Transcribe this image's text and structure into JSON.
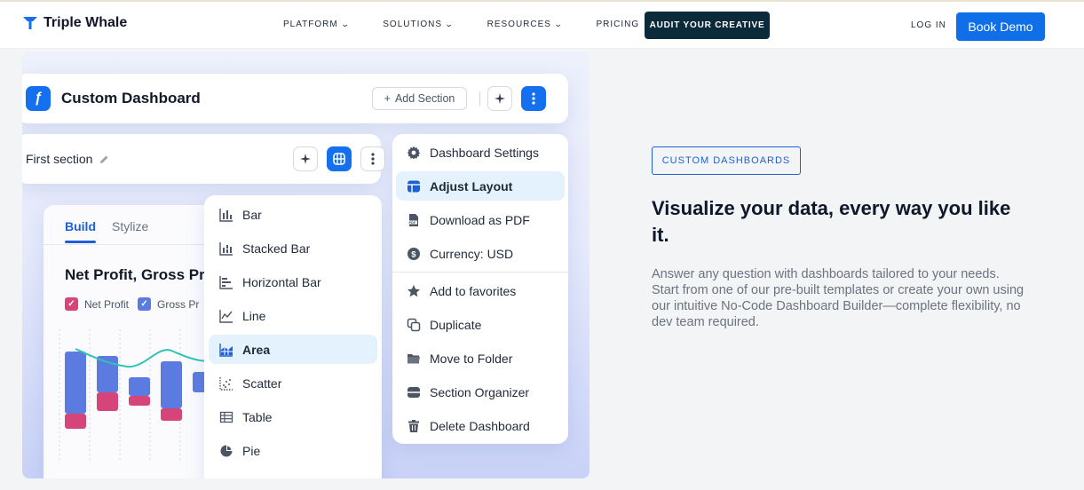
{
  "nav": {
    "brand": "Triple Whale",
    "links": [
      {
        "label": "PLATFORM",
        "has_dropdown": true
      },
      {
        "label": "SOLUTIONS",
        "has_dropdown": true
      },
      {
        "label": "RESOURCES",
        "has_dropdown": true
      },
      {
        "label": "PRICING",
        "has_dropdown": false
      }
    ],
    "audit_label": "AUDIT YOUR CREATIVE",
    "login_label": "LOG IN",
    "demo_label": "Book Demo"
  },
  "dashboard": {
    "title": "Custom Dashboard",
    "add_section_label": "Add Section",
    "section_title": "First section",
    "tabs": {
      "build": "Build",
      "stylize": "Stylize"
    },
    "metric_title": "Net Profit, Gross Pr",
    "legend": [
      {
        "label": "Net Profit",
        "color": "#d6457a"
      },
      {
        "label": "Gross Pr",
        "color": "#5b7be0"
      }
    ]
  },
  "chart_types": [
    {
      "label": "Bar",
      "icon": "bar-chart-icon"
    },
    {
      "label": "Stacked Bar",
      "icon": "stacked-bar-icon"
    },
    {
      "label": "Horizontal Bar",
      "icon": "horizontal-bar-icon"
    },
    {
      "label": "Line",
      "icon": "line-chart-icon"
    },
    {
      "label": "Area",
      "icon": "area-chart-icon",
      "active": true
    },
    {
      "label": "Scatter",
      "icon": "scatter-icon"
    },
    {
      "label": "Table",
      "icon": "table-icon"
    },
    {
      "label": "Pie",
      "icon": "pie-icon"
    }
  ],
  "settings_menu": [
    {
      "label": "Dashboard Settings",
      "icon": "gear-icon"
    },
    {
      "label": "Adjust Layout",
      "icon": "layout-icon",
      "active": true
    },
    {
      "label": "Download as PDF",
      "icon": "pdf-icon"
    },
    {
      "label": "Currency: USD",
      "icon": "currency-icon"
    },
    {
      "label": "Add to favorites",
      "icon": "star-icon"
    },
    {
      "label": "Duplicate",
      "icon": "duplicate-icon"
    },
    {
      "label": "Move to Folder",
      "icon": "folder-icon"
    },
    {
      "label": "Section Organizer",
      "icon": "organizer-icon"
    },
    {
      "label": "Delete Dashboard",
      "icon": "trash-icon"
    }
  ],
  "content": {
    "badge": "CUSTOM DASHBOARDS",
    "headline": "Visualize your data, every way you like it.",
    "description": "Answer any question with dashboards tailored to your needs. Start from one of our pre-built templates or create your own using our intuitive No-Code Dashboard Builder—complete flexibility, no dev team required."
  },
  "colors": {
    "accent": "#1570ef",
    "dark_button": "#0b2a3a",
    "bar_blue": "#5b7be0",
    "bar_pink": "#d6457a",
    "line_teal": "#2fc4b2"
  }
}
